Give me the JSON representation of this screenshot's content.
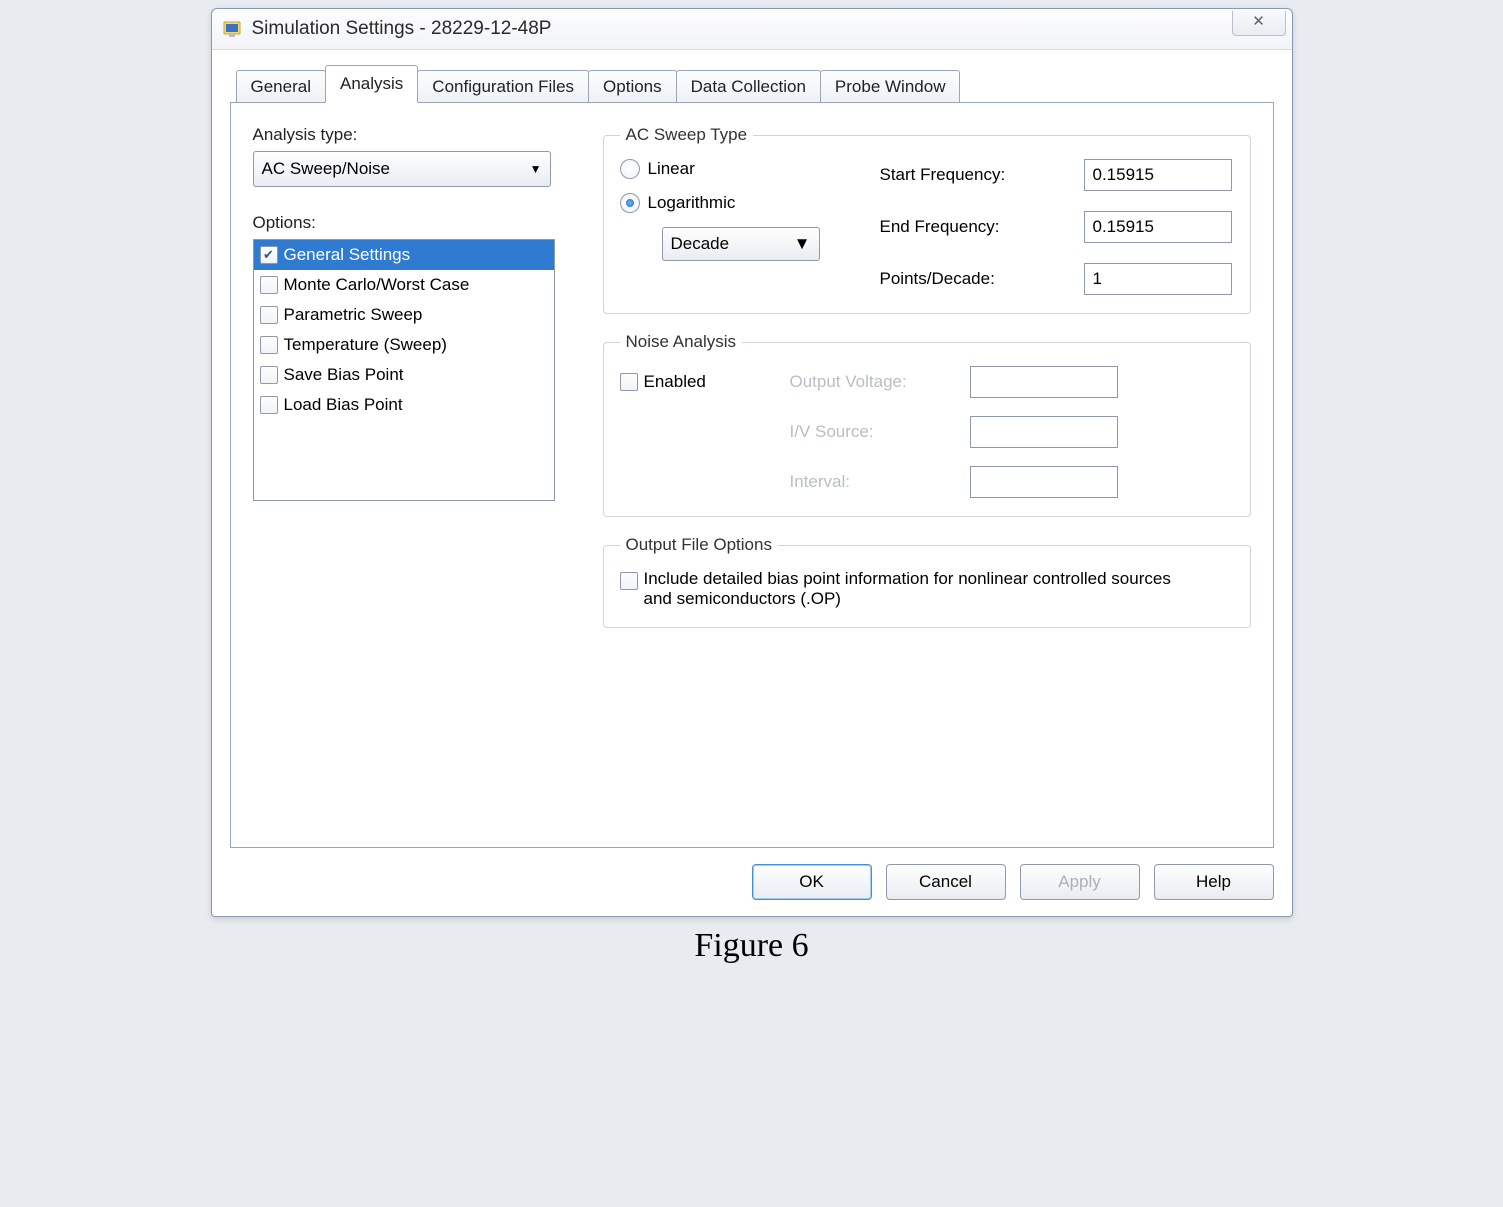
{
  "window": {
    "title": "Simulation Settings - 28229-12-48P",
    "close_glyph": "✕"
  },
  "tabs": [
    {
      "label": "General"
    },
    {
      "label": "Analysis"
    },
    {
      "label": "Configuration Files"
    },
    {
      "label": "Options"
    },
    {
      "label": "Data Collection"
    },
    {
      "label": "Probe Window"
    }
  ],
  "active_tab": 1,
  "analysis": {
    "type_label": "Analysis type:",
    "type_value": "AC Sweep/Noise",
    "options_label": "Options:",
    "options": [
      {
        "label": "General Settings",
        "checked": true,
        "selected": true
      },
      {
        "label": "Monte Carlo/Worst Case",
        "checked": false
      },
      {
        "label": "Parametric Sweep",
        "checked": false
      },
      {
        "label": "Temperature (Sweep)",
        "checked": false
      },
      {
        "label": "Save Bias Point",
        "checked": false
      },
      {
        "label": "Load Bias Point",
        "checked": false
      }
    ]
  },
  "ac_sweep": {
    "legend": "AC Sweep Type",
    "linear_label": "Linear",
    "linear_selected": false,
    "log_label": "Logarithmic",
    "log_selected": true,
    "scale_value": "Decade",
    "start_label": "Start Frequency:",
    "start_value": "0.15915",
    "end_label": "End Frequency:",
    "end_value": "0.15915",
    "pts_label": "Points/Decade:",
    "pts_value": "1"
  },
  "noise": {
    "legend": "Noise Analysis",
    "enabled_label": "Enabled",
    "enabled": false,
    "out_label": "Output Voltage:",
    "iv_label": "I/V Source:",
    "interval_label": "Interval:"
  },
  "output_file": {
    "legend": "Output File Options",
    "include_label": "Include detailed bias point information for nonlinear controlled sources and semiconductors (.OP)",
    "include_checked": false
  },
  "buttons": {
    "ok": "OK",
    "cancel": "Cancel",
    "apply": "Apply",
    "help": "Help"
  },
  "figure_caption": "Figure 6"
}
